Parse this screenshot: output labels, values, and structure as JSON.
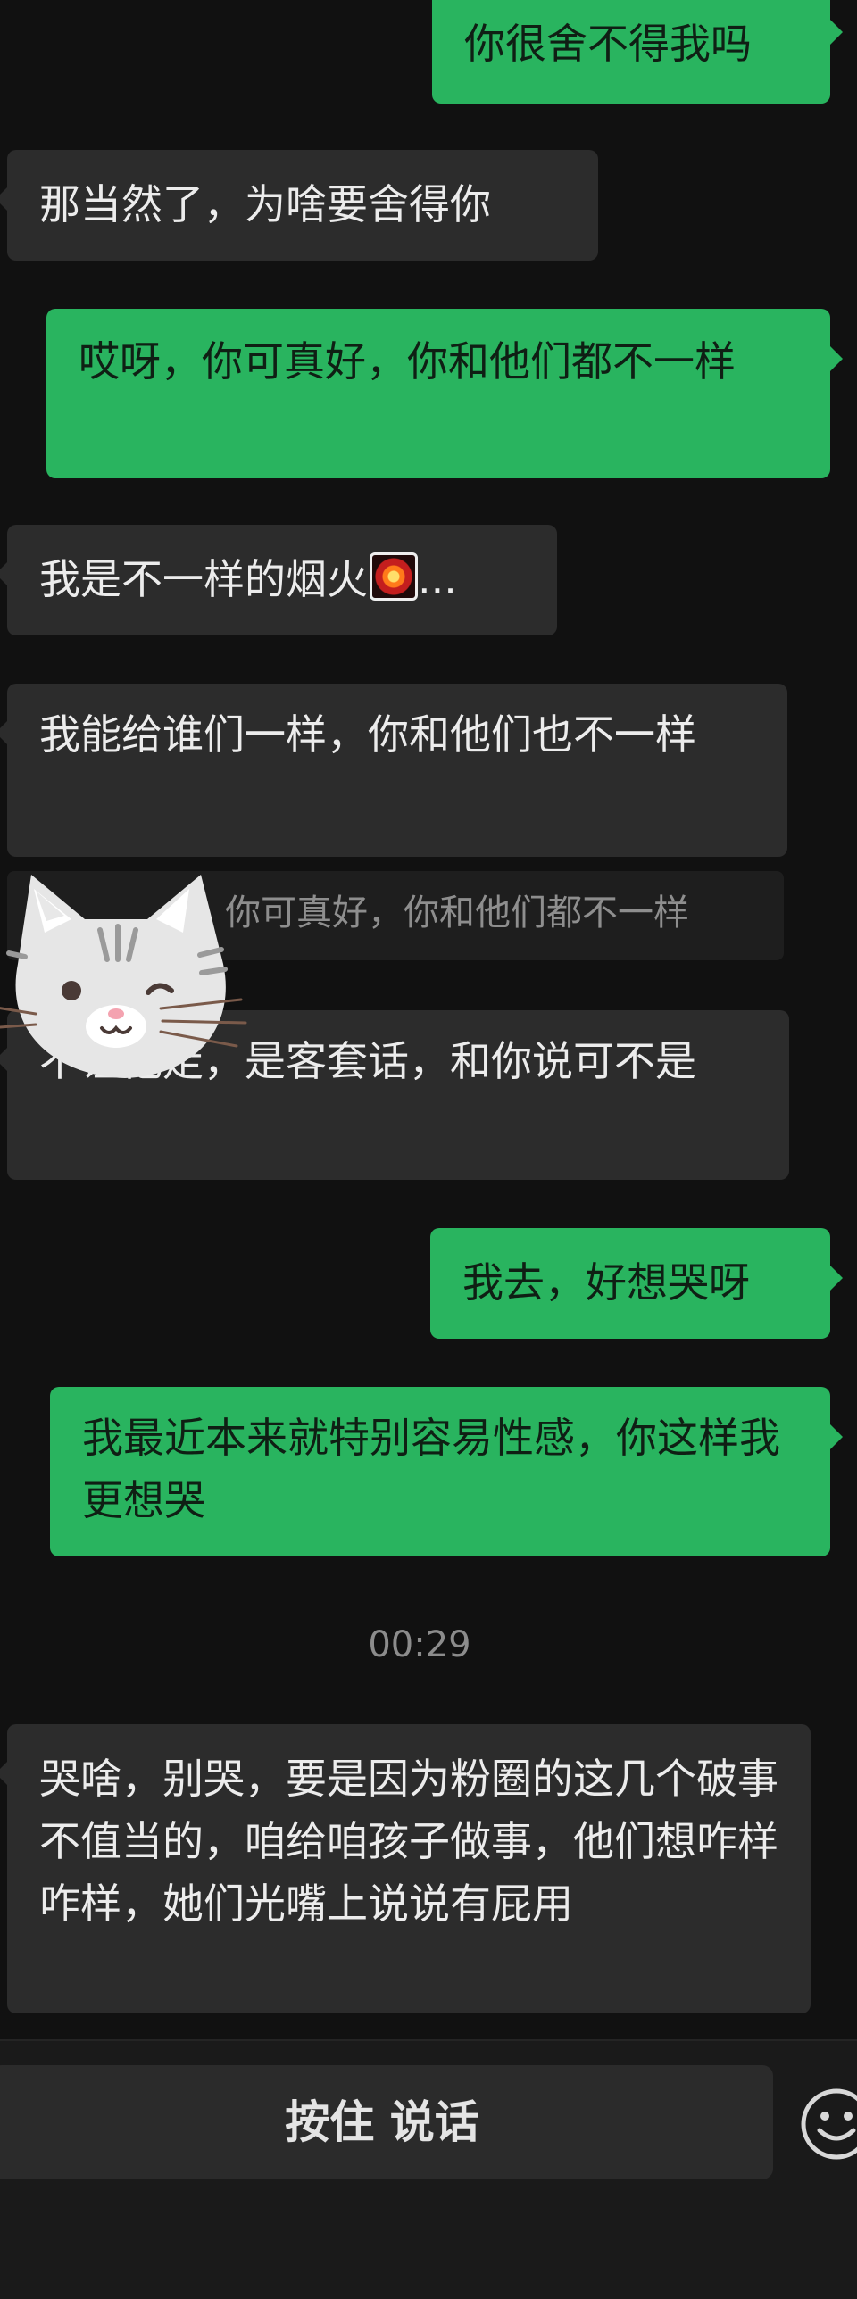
{
  "messages": [
    {
      "side": "out",
      "text": "你很舍不得我吗"
    },
    {
      "side": "in",
      "text": "那当然了，为啥要舍得你"
    },
    {
      "side": "out",
      "text": "哎呀，你可真好，你和他们都不一样"
    },
    {
      "side": "in",
      "text": "我是不一样的烟火",
      "suffix": "..."
    },
    {
      "side": "in",
      "text": "我能给谁们一样，你和他们也不一样"
    },
    {
      "side": "in",
      "text": "你可真好，你和他们都不一样",
      "quoted": true
    },
    {
      "side": "in",
      "text": "不让他走，是客套话，和你说可不是"
    },
    {
      "side": "out",
      "text": "我去，好想哭呀"
    },
    {
      "side": "out",
      "text": "我最近本来就特别容易性感，你这样我更想哭"
    },
    {
      "side": "in",
      "text": "哭啥，别哭，要是因为粉圈的这几个破事不值当的，咱给咱孩子做事，他们想咋样咋样，她们光嘴上说说有屁用"
    }
  ],
  "timestamp": "00:29",
  "input_bar": {
    "hold_to_talk_label": "按住 说话"
  },
  "icons": {
    "firework": "firework-emoji-icon",
    "sticker": "cat-sticker-icon",
    "emoji": "emoji-smiley-icon"
  },
  "colors": {
    "background": "#111111",
    "outgoing_bubble": "#29b45f",
    "incoming_bubble": "#2c2c2c"
  }
}
